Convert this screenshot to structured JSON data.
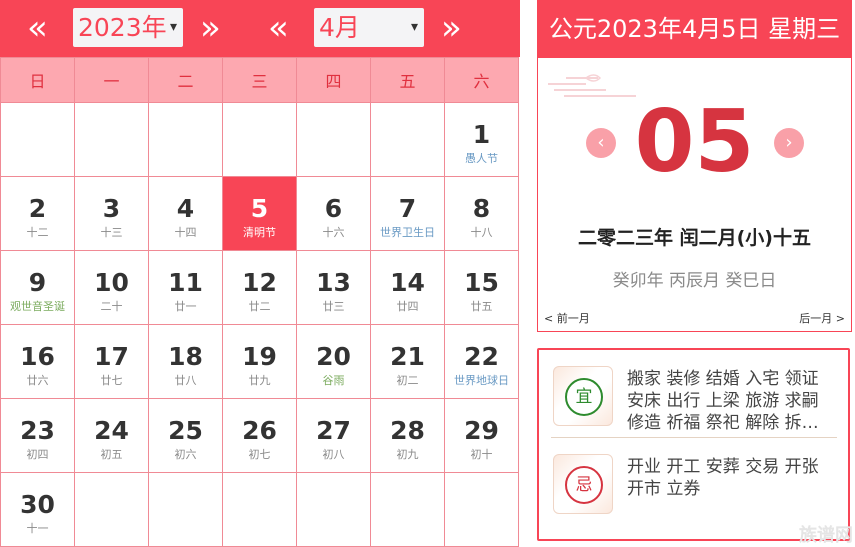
{
  "header": {
    "prev_year_icon": "«",
    "next_year_icon": "»",
    "prev_month_icon": "«",
    "next_month_icon": "»",
    "year_value": "2023年",
    "month_value": "4月",
    "caret": "▾"
  },
  "weekdays": [
    "日",
    "一",
    "二",
    "三",
    "四",
    "五",
    "六"
  ],
  "weeks": [
    [
      null,
      null,
      null,
      null,
      null,
      null,
      {
        "d": "1",
        "sub": "愚人节",
        "kind": "fest"
      }
    ],
    [
      {
        "d": "2",
        "sub": "十二"
      },
      {
        "d": "3",
        "sub": "十三"
      },
      {
        "d": "4",
        "sub": "十四"
      },
      {
        "d": "5",
        "sub": "清明节",
        "kind": "today"
      },
      {
        "d": "6",
        "sub": "十六"
      },
      {
        "d": "7",
        "sub": "世界卫生日",
        "kind": "fest"
      },
      {
        "d": "8",
        "sub": "十八"
      }
    ],
    [
      {
        "d": "9",
        "sub": "观世音圣诞",
        "kind": "term"
      },
      {
        "d": "10",
        "sub": "二十"
      },
      {
        "d": "11",
        "sub": "廿一"
      },
      {
        "d": "12",
        "sub": "廿二"
      },
      {
        "d": "13",
        "sub": "廿三"
      },
      {
        "d": "14",
        "sub": "廿四"
      },
      {
        "d": "15",
        "sub": "廿五"
      }
    ],
    [
      {
        "d": "16",
        "sub": "廿六"
      },
      {
        "d": "17",
        "sub": "廿七"
      },
      {
        "d": "18",
        "sub": "廿八"
      },
      {
        "d": "19",
        "sub": "廿九"
      },
      {
        "d": "20",
        "sub": "谷雨",
        "kind": "term"
      },
      {
        "d": "21",
        "sub": "初二"
      },
      {
        "d": "22",
        "sub": "世界地球日",
        "kind": "fest"
      }
    ],
    [
      {
        "d": "23",
        "sub": "初四"
      },
      {
        "d": "24",
        "sub": "初五"
      },
      {
        "d": "25",
        "sub": "初六"
      },
      {
        "d": "26",
        "sub": "初七"
      },
      {
        "d": "27",
        "sub": "初八"
      },
      {
        "d": "28",
        "sub": "初九"
      },
      {
        "d": "29",
        "sub": "初十"
      }
    ],
    [
      {
        "d": "30",
        "sub": "十一"
      },
      null,
      null,
      null,
      null,
      null,
      null
    ]
  ],
  "side": {
    "title": "公元2023年4月5日 星期三",
    "day": "05",
    "prev_icon": "‹",
    "next_icon": "›",
    "lunar": "二零二三年 闰二月(小)十五",
    "ganzhi": "癸卯年 丙辰月 癸巳日",
    "prev_month": "< 前一月",
    "next_month": "后一月 >"
  },
  "yiji": {
    "yi_label": "宜",
    "yi_text": "搬家 装修 结婚 入宅 领证 安床 出行 上梁 旅游 求嗣 修造 祈福 祭祀 解除 拆…",
    "ji_label": "忌",
    "ji_text": "开业 开工 安葬 交易 开张 开市 立券"
  },
  "watermark": "族谱网",
  "colors": {
    "accent": "#f84556",
    "header_row": "#fda8b0",
    "grid_line": "#f08a95",
    "yi": "#2e8b2e",
    "ji": "#d63440"
  }
}
